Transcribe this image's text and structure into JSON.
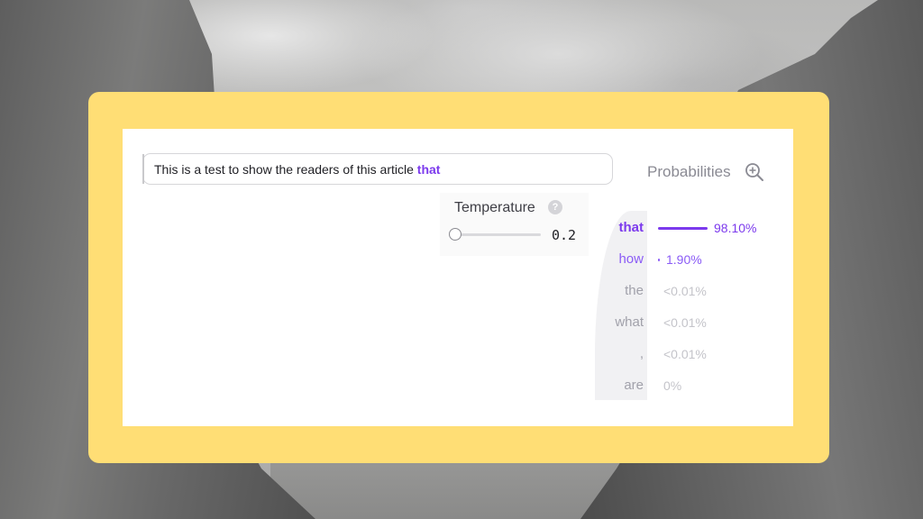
{
  "prompt": {
    "text": "This is a test to show the readers of this article",
    "highlight": "that"
  },
  "probabilities": {
    "title": "Probabilities",
    "zoom_icon": "zoom-in-icon"
  },
  "temperature": {
    "label": "Temperature",
    "help_symbol": "?",
    "value": "0.2",
    "slider_fraction": 0.0
  },
  "tokens": [
    {
      "token": "that",
      "percent": "98.10%",
      "fraction": 0.981,
      "color": "#7c3aed"
    },
    {
      "token": "how",
      "percent": "1.90%",
      "fraction": 0.019,
      "color": "#8b5cf6"
    },
    {
      "token": "the",
      "percent": "<0.01%",
      "fraction": 0.0,
      "color": "#a1a1aa"
    },
    {
      "token": "what",
      "percent": "<0.01%",
      "fraction": 0.0,
      "color": "#a1a1aa"
    },
    {
      "token": ",",
      "percent": "<0.01%",
      "fraction": 0.0,
      "color": "#a1a1aa"
    },
    {
      "token": "are",
      "percent": "0%",
      "fraction": 0.0,
      "color": "#a1a1aa"
    }
  ],
  "colors": {
    "accent": "#7c3aed",
    "frame": "#ffde75",
    "muted": "#a1a1aa"
  }
}
